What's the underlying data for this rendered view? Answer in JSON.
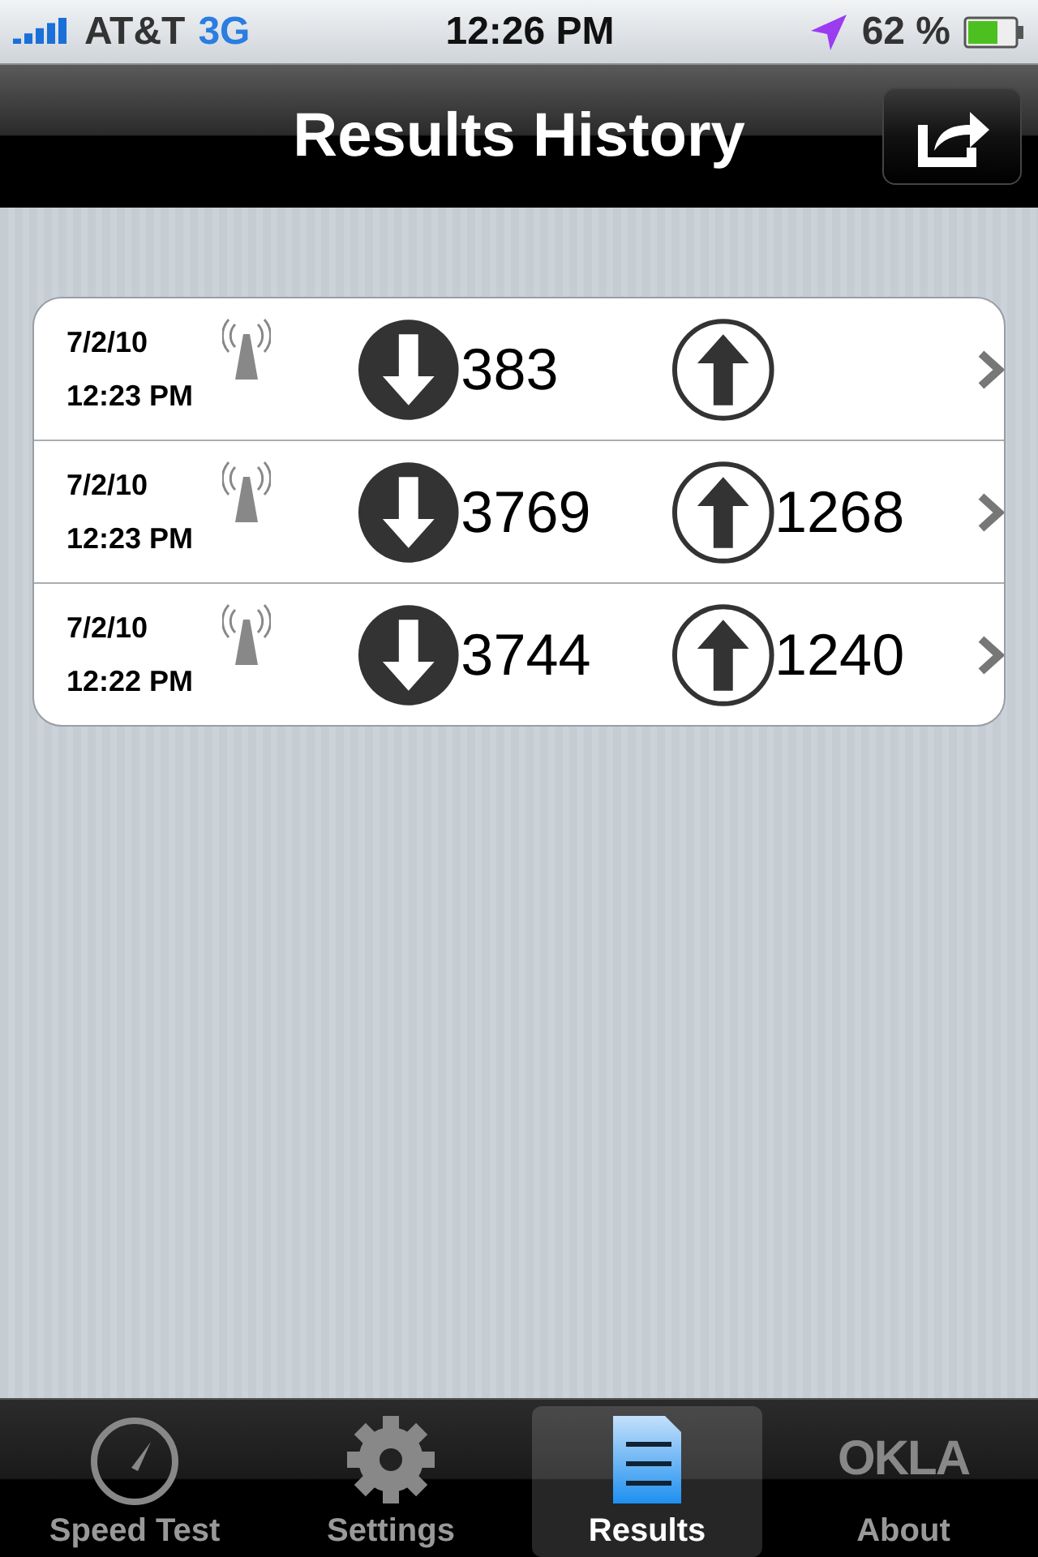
{
  "status_bar": {
    "carrier": "AT&T",
    "network": "3G",
    "time": "12:26 PM",
    "battery": "62 %"
  },
  "nav_bar": {
    "title": "Results History"
  },
  "results": [
    {
      "date": "7/2/10",
      "time": "12:23 PM",
      "download": "383"
    },
    {
      "date": "7/2/10",
      "time": "12:23 PM",
      "download": "3769",
      "upload": "1268"
    },
    {
      "date": "7/2/10",
      "time": "12:22 PM",
      "download": "3744",
      "upload": "1240"
    }
  ],
  "tab_bar": [
    {
      "kind": "gauge",
      "label": "Speed Test",
      "selected": false
    },
    {
      "kind": "gear",
      "label": "Settings",
      "selected": false
    },
    {
      "kind": "document",
      "label": "Results",
      "selected": true
    },
    {
      "kind": "logo",
      "logo": "OKLA",
      "label": "About",
      "selected": false
    }
  ]
}
